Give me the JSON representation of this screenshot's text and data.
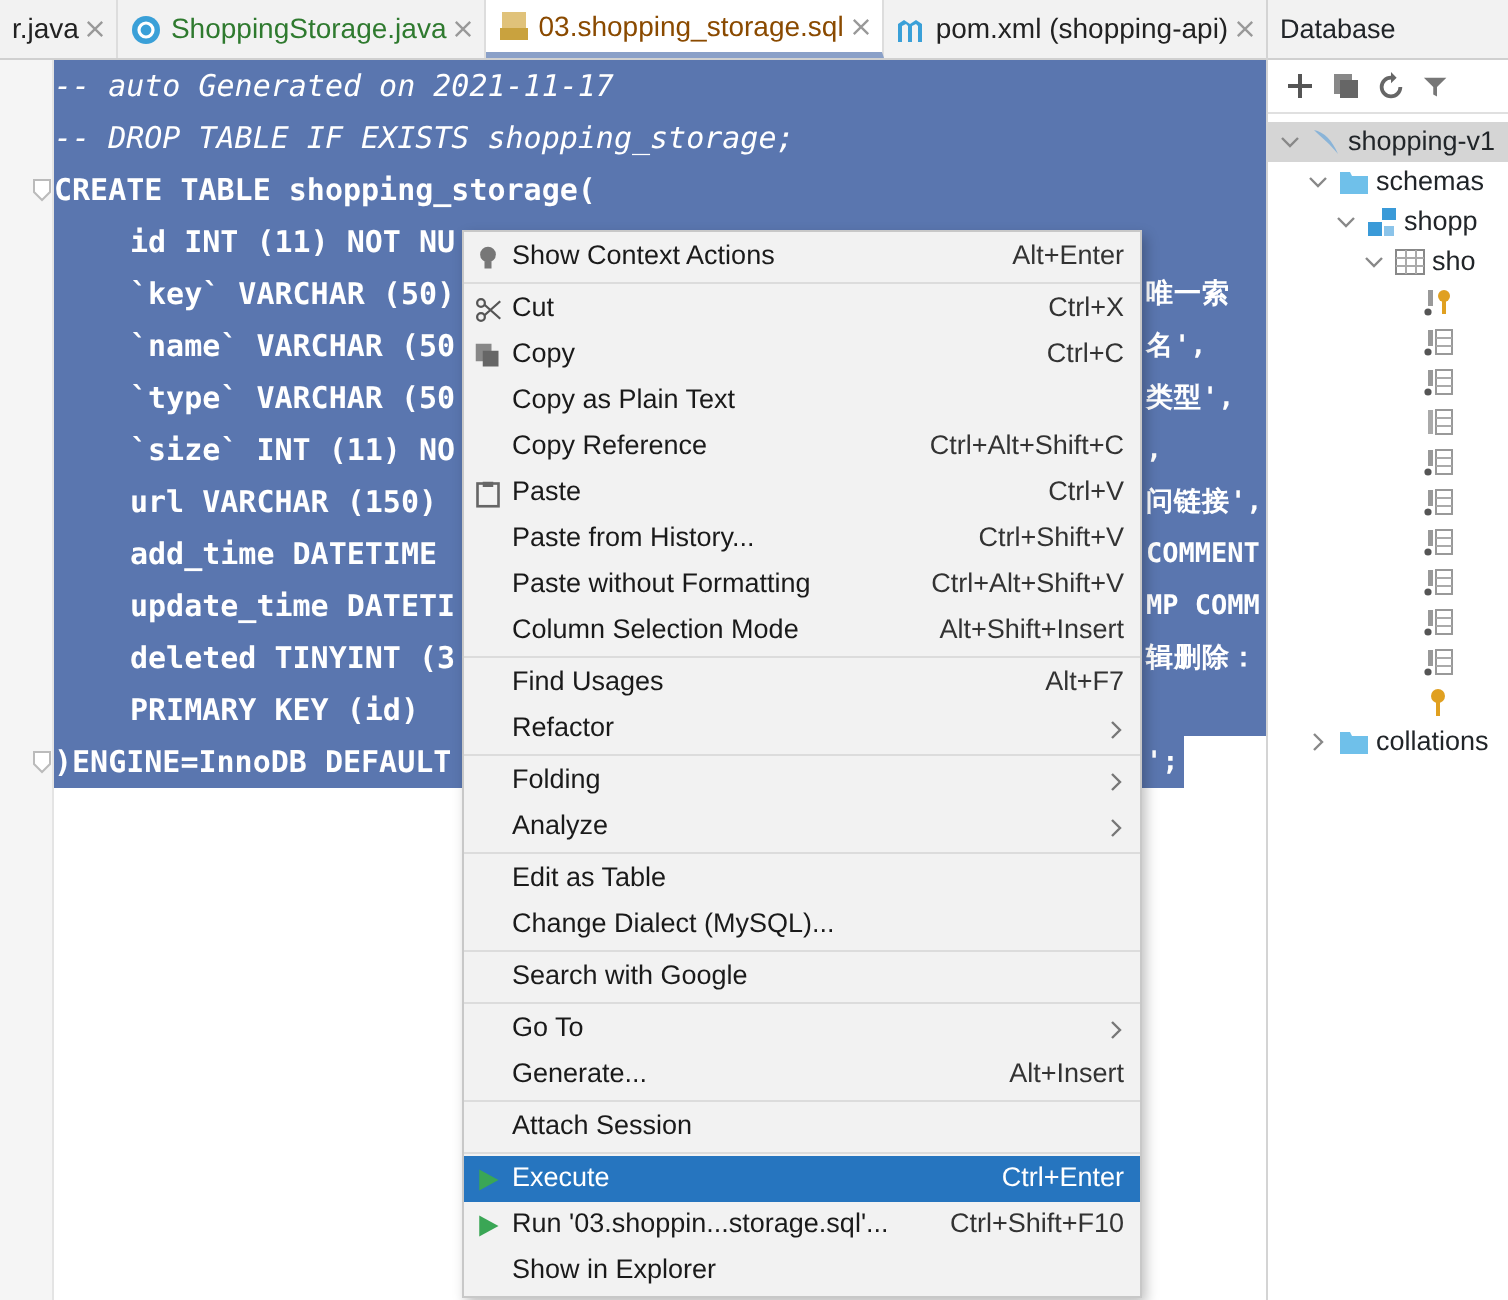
{
  "tabs": [
    {
      "label": "r.java",
      "kind": "plain",
      "selected": false
    },
    {
      "label": "ShoppingStorage.java",
      "kind": "class",
      "selected": false
    },
    {
      "label": "03.shopping_storage.sql",
      "kind": "sql",
      "selected": true
    },
    {
      "label": "pom.xml (shopping-api)",
      "kind": "maven",
      "selected": false
    }
  ],
  "editor": {
    "lines": [
      {
        "text": "-- auto Generated on 2021-11-17",
        "kind": "comment",
        "indent": false
      },
      {
        "text": "-- DROP TABLE IF EXISTS shopping_storage;",
        "kind": "comment",
        "indent": false
      },
      {
        "text": "CREATE TABLE shopping_storage(",
        "kind": "code",
        "indent": false,
        "fold": true
      },
      {
        "text": "id INT (11) NOT NU",
        "kind": "code",
        "indent": true
      },
      {
        "text": "`key` VARCHAR (50)",
        "kind": "code",
        "indent": true,
        "tail": "唯一索"
      },
      {
        "text": "`name` VARCHAR (50",
        "kind": "code",
        "indent": true,
        "tail": "名',"
      },
      {
        "text": "`type` VARCHAR (50",
        "kind": "code",
        "indent": true,
        "tail": "类型',"
      },
      {
        "text": "`size` INT (11) NO",
        "kind": "code",
        "indent": true,
        "tail": ","
      },
      {
        "text": "url VARCHAR (150)",
        "kind": "code",
        "indent": true,
        "tail": "问链接',"
      },
      {
        "text": "add_time DATETIME",
        "kind": "code",
        "indent": true,
        "tail": "COMMENT"
      },
      {
        "text": "update_time DATETI",
        "kind": "code",
        "indent": true,
        "tail": "MP COMM"
      },
      {
        "text": "deleted TINYINT (3",
        "kind": "code",
        "indent": true,
        "tail": "辑删除："
      },
      {
        "text": "PRIMARY KEY (id)",
        "kind": "code",
        "indent": true
      },
      {
        "text": ")ENGINE=InnoDB DEFAULT",
        "kind": "code",
        "indent": false,
        "fold": true,
        "tail": "';",
        "last": true
      }
    ]
  },
  "context_menu": {
    "groups": [
      [
        {
          "label": "Show Context Actions",
          "shortcut": "Alt+Enter",
          "kind": "intention",
          "selected": false
        }
      ],
      [
        {
          "label": "Cut",
          "shortcut": "Ctrl+X",
          "kind": "cut",
          "selected": false
        },
        {
          "label": "Copy",
          "shortcut": "Ctrl+C",
          "kind": "copy",
          "selected": false
        },
        {
          "label": "Copy as Plain Text",
          "selected": false
        },
        {
          "label": "Copy Reference",
          "shortcut": "Ctrl+Alt+Shift+C",
          "selected": false
        },
        {
          "label": "Paste",
          "shortcut": "Ctrl+V",
          "kind": "paste",
          "selected": false
        },
        {
          "label": "Paste from History...",
          "shortcut": "Ctrl+Shift+V",
          "selected": false
        },
        {
          "label": "Paste without Formatting",
          "shortcut": "Ctrl+Alt+Shift+V",
          "selected": false
        },
        {
          "label": "Column Selection Mode",
          "shortcut": "Alt+Shift+Insert",
          "selected": false
        }
      ],
      [
        {
          "label": "Find Usages",
          "shortcut": "Alt+F7",
          "selected": false
        },
        {
          "label": "Refactor",
          "submenu": true,
          "selected": false
        }
      ],
      [
        {
          "label": "Folding",
          "submenu": true,
          "selected": false
        },
        {
          "label": "Analyze",
          "submenu": true,
          "selected": false
        }
      ],
      [
        {
          "label": "Edit as Table",
          "selected": false
        },
        {
          "label": "Change Dialect (MySQL)...",
          "selected": false
        }
      ],
      [
        {
          "label": "Search with Google",
          "selected": false
        }
      ],
      [
        {
          "label": "Go To",
          "submenu": true,
          "selected": false
        },
        {
          "label": "Generate...",
          "shortcut": "Alt+Insert",
          "selected": false
        }
      ],
      [
        {
          "label": "Attach Session",
          "selected": false
        }
      ],
      [
        {
          "label": "Execute",
          "shortcut": "Ctrl+Enter",
          "kind": "run",
          "selected": true
        },
        {
          "label": "Run '03.shoppin...storage.sql'...",
          "shortcut": "Ctrl+Shift+F10",
          "kind": "run",
          "selected": false
        },
        {
          "label": "Show in Explorer",
          "selected": false
        }
      ]
    ]
  },
  "database": {
    "title": "Database",
    "tree": [
      {
        "label": "shopping-v1",
        "kind": "datasource",
        "expanded": true,
        "selected": true,
        "children": [
          {
            "label": "schemas",
            "kind": "folder",
            "expanded": true,
            "children": [
              {
                "label": "shopp",
                "kind": "schema",
                "expanded": true,
                "children": [
                  {
                    "label": "sho",
                    "kind": "table",
                    "expanded": true,
                    "children": [
                      {
                        "kind": "pk-column"
                      },
                      {
                        "kind": "column"
                      },
                      {
                        "kind": "column"
                      },
                      {
                        "kind": "plain-column"
                      },
                      {
                        "kind": "column"
                      },
                      {
                        "kind": "column"
                      },
                      {
                        "kind": "column"
                      },
                      {
                        "kind": "column"
                      },
                      {
                        "kind": "column"
                      },
                      {
                        "kind": "column"
                      },
                      {
                        "kind": "key"
                      }
                    ]
                  }
                ]
              }
            ]
          },
          {
            "label": "collations",
            "kind": "folder",
            "expanded": false
          }
        ]
      }
    ]
  }
}
